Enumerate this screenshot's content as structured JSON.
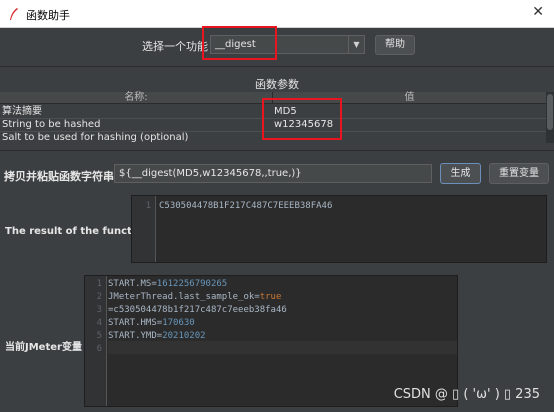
{
  "window": {
    "title": "函数助手",
    "close_symbol": "✕"
  },
  "function_selector": {
    "label": "选择一个功能",
    "selected": "__digest",
    "dropdown_arrow": "▼",
    "help_button": "帮助"
  },
  "params": {
    "section_title": "函数参数",
    "columns": [
      "名称:",
      "值"
    ],
    "rows": [
      {
        "name": "算法摘要",
        "value": "MD5"
      },
      {
        "name": "String to be hashed",
        "value": "w12345678"
      },
      {
        "name": "Salt to be used for hashing (optional)",
        "value": ""
      }
    ]
  },
  "function_string": {
    "label": "拷贝并粘贴函数字符串",
    "value": "${__digest(MD5,w12345678,,true,)}",
    "generate_button": "生成",
    "reset_button": "重置变量"
  },
  "result": {
    "label": "The result of the function is",
    "line_numbers": [
      "1"
    ],
    "lines": [
      "C530504478B1F217C487C7EEEB38FA46"
    ]
  },
  "jmeter_vars": {
    "label": "当前JMeter变量",
    "line_numbers": [
      "1",
      "2",
      "3",
      "4",
      "5",
      "6"
    ],
    "lines": [
      {
        "key": "START.MS=",
        "val": "1612256790265",
        "kind": "num"
      },
      {
        "key": "JMeterThread.last_sample_ok=",
        "val": "true",
        "kind": "kw"
      },
      {
        "key": "=c530504478b1f217c487c7eeeb38fa46",
        "val": "",
        "kind": "plain"
      },
      {
        "key": "START.HMS=",
        "val": "170630",
        "kind": "num"
      },
      {
        "key": "START.YMD=",
        "val": "20210202",
        "kind": "num"
      },
      {
        "key": "",
        "val": "",
        "kind": "plain"
      }
    ]
  },
  "watermark": "CSDN @ ▯ ( 'ω' ) ▯ 235",
  "colors": {
    "background": "#3c3f41",
    "highlight": "#e8141f",
    "number": "#6897bb",
    "keyword": "#cc7832"
  }
}
